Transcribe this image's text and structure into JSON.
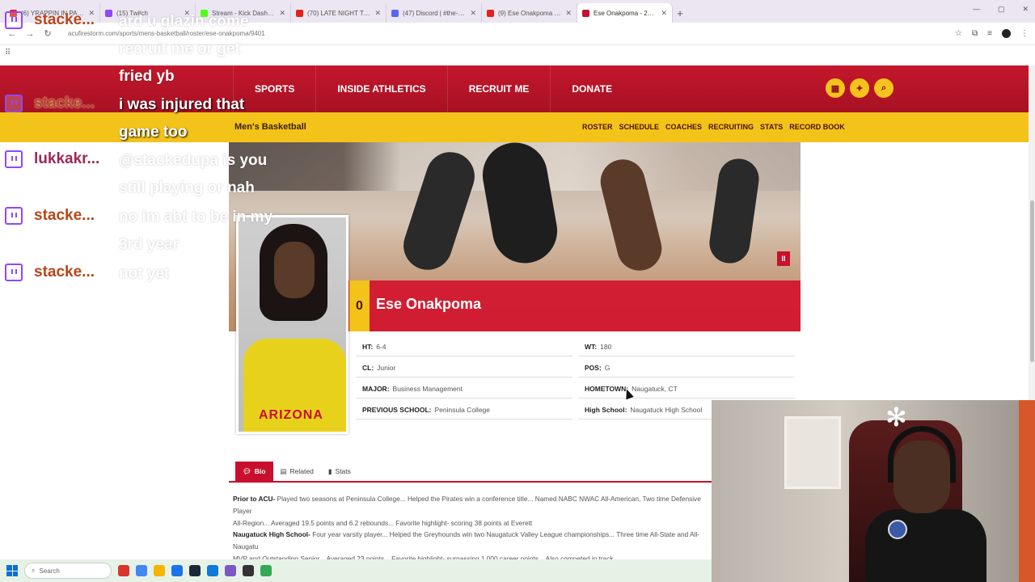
{
  "browser": {
    "tabs": [
      {
        "label": "(6) YRAPPIN IN PARADI",
        "color": "#e62117",
        "active": false
      },
      {
        "label": "(15) Twitch",
        "color": "#9146ff",
        "active": false
      },
      {
        "label": "Stream - Kick Dashboard",
        "color": "#53fc18",
        "active": false
      },
      {
        "label": "(70) LATE NIGHT TYPE VIBBE",
        "color": "#e62117",
        "active": false
      },
      {
        "label": "(47) Discord | #the-astronomi",
        "color": "#5865f2",
        "active": false
      },
      {
        "label": "(9) Ese Onakpoma basketball",
        "color": "#e62117",
        "active": false
      },
      {
        "label": "Ese Onakpoma - 2024-25 - Me",
        "color": "#c8102e",
        "active": true
      }
    ],
    "url": "acufirestorm.com/sports/mens-basketball/roster/ese-onakpoma/9401"
  },
  "site": {
    "nav": [
      "SPORTS",
      "INSIDE ATHLETICS",
      "RECRUIT ME",
      "DONATE"
    ],
    "sport": "Men's Basketball",
    "subnav": [
      "ROSTER",
      "SCHEDULE",
      "COACHES",
      "RECRUITING",
      "STATS",
      "RECORD BOOK"
    ],
    "accent": "#c8102e",
    "gold": "#f4c319"
  },
  "player": {
    "number": "0",
    "name": "Ese Onakpoma",
    "jersey_text": "ARIZONA",
    "vitals": {
      "ht_label": "HT:",
      "ht": "6-4",
      "wt_label": "WT:",
      "wt": "180",
      "cl_label": "CL:",
      "cl": "Junior",
      "pos_label": "POS:",
      "pos": "G",
      "major_label": "MAJOR:",
      "major": "Business Management",
      "hometown_label": "HOMETOWN:",
      "hometown": "Naugatuck, CT",
      "prev_label": "PREVIOUS SCHOOL:",
      "prev": "Peninsula College",
      "hs_label": "High School:",
      "hs": "Naugatuck High School"
    }
  },
  "tabs": [
    "Bio",
    "Related",
    "Stats"
  ],
  "bio": {
    "p1_head": "Prior to ACU-",
    "p1": " Played two seasons at Peninsula College... Helped the Pirates win a conference title... Named NABC NWAC All-American, Two time Defensive Player",
    "p1b": "All-Region... Averaged 19.5 points and 6.2 rebounds... Favorite highlight- scoring 38 points at Everett",
    "p2_head": "Naugatuck High School-",
    "p2": " Four year varsity player... Helped the Greyhounds win two Naugatuck Valley League championships... Three time All-State and All-Naugatu",
    "p2b": "MVP and Outstanding Senior... Averaged 23 points... Favorite highlight- surpassing 1,000 career points... Also competed in track"
  },
  "chat": [
    {
      "user": "stacke...",
      "msg": "ard u glazin come recruit me or get fried yb"
    },
    {
      "user": "stacke...",
      "msg": "i was injured that game too"
    },
    {
      "user": "lukkakr...",
      "msg": "@stackedupa is you still playing or nah"
    },
    {
      "user": "stacke...",
      "msg": "no im abt to be in my 3rd year"
    },
    {
      "user": "stacke...",
      "msg": "not yet"
    }
  ],
  "taskbar": {
    "search": "Search"
  }
}
